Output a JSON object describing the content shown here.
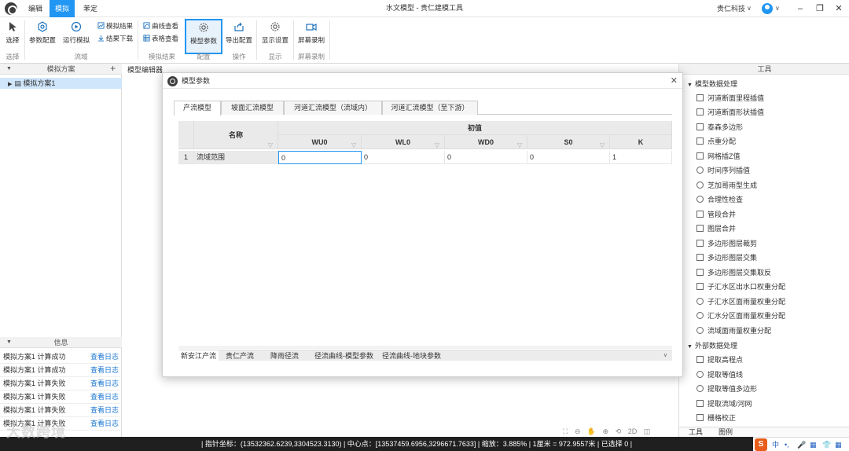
{
  "app": {
    "title": "水文模型 - 贵仁建模工具",
    "menu_tabs": [
      "编辑",
      "模拟",
      "苯定"
    ],
    "active_menu": "模拟",
    "company": "贵仁科技",
    "window_controls": [
      "–",
      "❐",
      "✕"
    ]
  },
  "ribbon": {
    "select_label": "选择",
    "param_config_label": "参数配置",
    "run_sim_label": "运行模拟",
    "sim_result_label": "模拟结果",
    "result_download_label": "结果下载",
    "curve_view_label": "曲线查看",
    "table_view_label": "表格查看",
    "model_params_label": "模型参数",
    "export_config_label": "导出配置",
    "display_settings_label": "显示设置",
    "screen_record_label": "屏幕录制",
    "groups": {
      "select": "选择",
      "flow": "流域",
      "sim_result": "模拟结果",
      "config": "配置",
      "operation": "操作",
      "display": "显示",
      "record": "屏幕录制"
    }
  },
  "left_panel": {
    "scheme_title": "模拟方案",
    "scheme_item": "模拟方案1",
    "info_title": "信息",
    "logs": [
      {
        "text": "模拟方案1 计算成功",
        "link": "查看日志"
      },
      {
        "text": "模拟方案1 计算成功",
        "link": "查看日志"
      },
      {
        "text": "模拟方案1 计算失败",
        "link": "查看日志"
      },
      {
        "text": "模拟方案1 计算失败",
        "link": "查看日志"
      },
      {
        "text": "模拟方案1 计算失败",
        "link": "查看日志"
      },
      {
        "text": "模拟方案1 计算失败",
        "link": "查看日志"
      }
    ]
  },
  "editor": {
    "tab_label": "模型编辑器"
  },
  "modal": {
    "title": "模型参数",
    "tabs": [
      "产流模型",
      "坡面汇流模型",
      "河道汇流模型（流域内）",
      "河道汇流模型（至下游）"
    ],
    "active_tab": "产流模型",
    "header_name": "名称",
    "header_initial": "初值",
    "columns": [
      "WU0",
      "WL0",
      "WD0",
      "S0",
      "K"
    ],
    "rows": [
      {
        "index": "1",
        "name": "流域范围",
        "values": [
          "0",
          "0",
          "0",
          "0",
          "1"
        ]
      }
    ],
    "bottom_tabs": [
      "新安江产流",
      "贵仁产流",
      "降雨径流",
      "径流曲线-模型参数",
      "径流曲线-地块参数"
    ],
    "active_bottom_tab": "新安江产流"
  },
  "right_panel": {
    "title": "工具",
    "groups": [
      {
        "label": "模型数据处理",
        "items": [
          "河道断面里程插值",
          "河道断面形状插值",
          "泰森多边形",
          "点重分配",
          "网格插Z值",
          "时间序列插值",
          "芝加哥雨型生成",
          "合理性检查",
          "管段合并",
          "图层合并",
          "多边形图层裁剪",
          "多边形图层交集",
          "多边形图层交集取反",
          "子汇水区出水口权重分配",
          "子汇水区面雨量权重分配",
          "汇水分区面雨量权重分配",
          "流域面雨量权重分配"
        ]
      },
      {
        "label": "外部数据处理",
        "items": [
          "提取高程点",
          "提取等值线",
          "提取等值多边形",
          "提取流域/河网",
          "栅格校正"
        ]
      }
    ],
    "bottom_tabs": [
      "工具",
      "图例"
    ]
  },
  "bottom_tools": [
    "⛶",
    "⊖",
    "✋",
    "⊕",
    "⟲",
    "2D",
    "◫"
  ],
  "status_bar": {
    "text": "| 指针坐标：(13532362.6239,3304523.3130) | 中心点：[13537459.6956,3296671.7633] | 缩放：3.885% | 1厘米 = 972.9557米 | 已选择 0 |"
  },
  "watermark": "大数跨境",
  "ime": {
    "logo": "S",
    "glyphs": [
      "中",
      "•,",
      "🎤",
      "▦",
      "👕",
      "▦"
    ]
  }
}
